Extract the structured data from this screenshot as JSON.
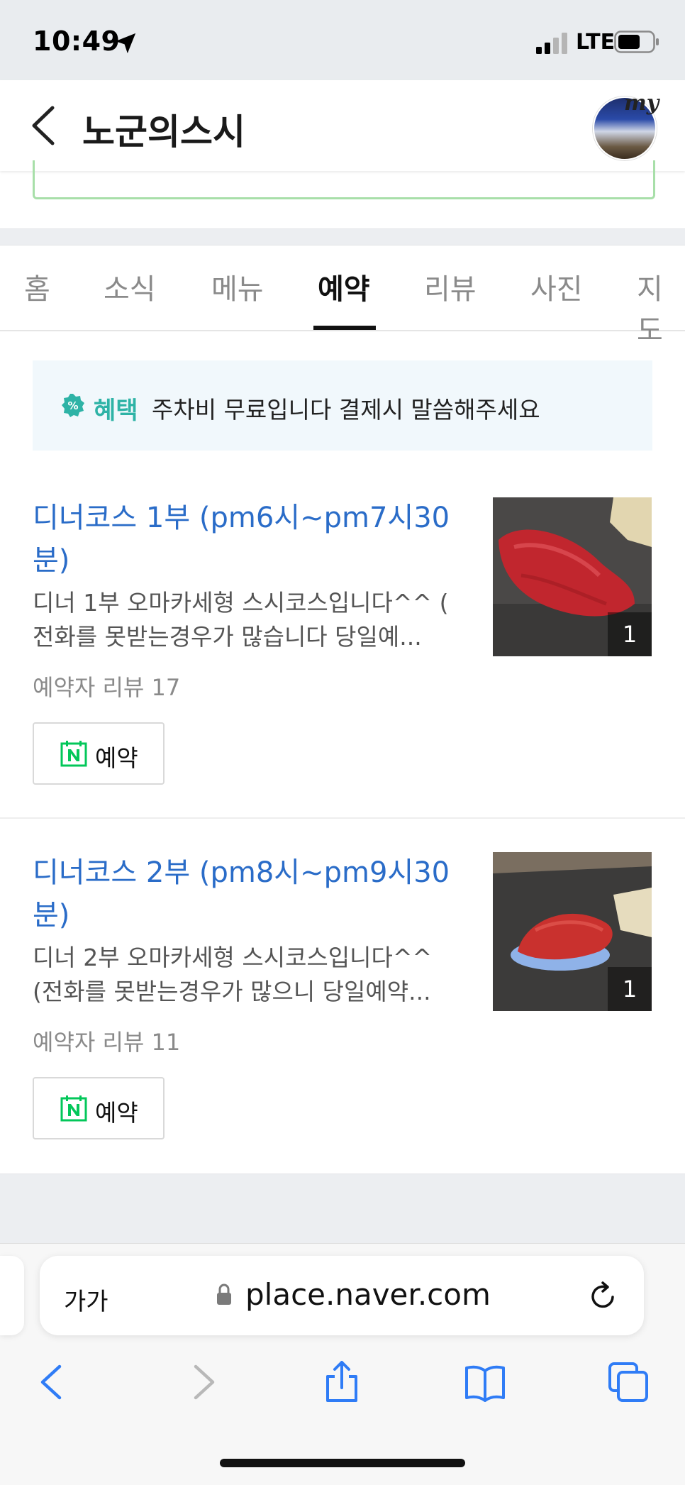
{
  "status_bar": {
    "time": "10:49",
    "carrier": "LTE"
  },
  "header": {
    "title": "노군의스시",
    "avatar_label": "my"
  },
  "tabs": [
    {
      "label": "홈",
      "active": false
    },
    {
      "label": "소식",
      "active": false
    },
    {
      "label": "메뉴",
      "active": false
    },
    {
      "label": "예약",
      "active": true
    },
    {
      "label": "리뷰",
      "active": false
    },
    {
      "label": "사진",
      "active": false
    },
    {
      "label": "지도",
      "active": false
    }
  ],
  "benefit": {
    "label": "혜택",
    "text": "주차비 무료입니다 결제시 말씀해주세요"
  },
  "items": [
    {
      "title": "디너코스 1부 (pm6시~pm7시30분)",
      "desc": "디너 1부 오마카세형 스시코스입니다^^ (\n전화를 못받는경우가 많습니다 당일예...",
      "review": "예약자 리뷰 17",
      "button": "예약",
      "photo_count": "1"
    },
    {
      "title": "디너코스 2부 (pm8시~pm9시30분)",
      "desc": "디너 2부 오마카세형 스시코스입니다^^\n(전화를 못받는경우가 많으니 당일예약...",
      "review": "예약자 리뷰 11",
      "button": "예약",
      "photo_count": "1"
    }
  ],
  "browser": {
    "text_size": "가가",
    "url": "place.naver.com"
  },
  "colors": {
    "link_blue": "#2a6cc8",
    "naver_green": "#03c75a",
    "benefit_teal": "#2eb3a6",
    "ios_blue": "#2f7cf6"
  }
}
